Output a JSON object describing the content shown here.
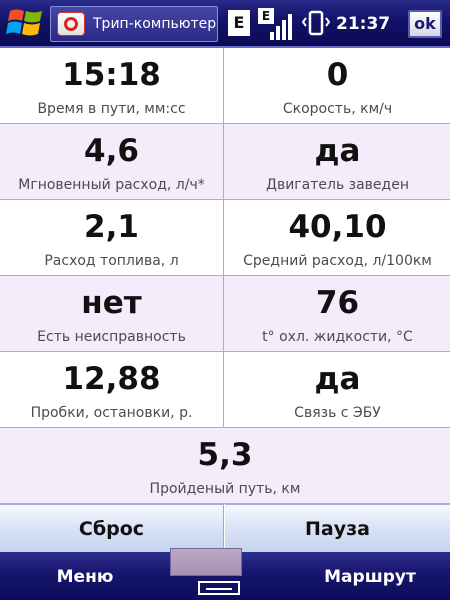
{
  "titlebar": {
    "app_title": "Трип-компьютер",
    "tray_e1": "E",
    "tray_e2": "E",
    "clock": "21:37",
    "ok_label": "ok"
  },
  "metrics": [
    {
      "value": "15:18",
      "label": "Время в пути, мм:сс"
    },
    {
      "value": "0",
      "label": "Скорость, км/ч"
    },
    {
      "value": "4,6",
      "label": "Мгновенный расход, л/ч*"
    },
    {
      "value": "да",
      "label": "Двигатель заведен"
    },
    {
      "value": "2,1",
      "label": "Расход топлива, л"
    },
    {
      "value": "40,10",
      "label": "Средний расход, л/100км"
    },
    {
      "value": "нет",
      "label": "Есть неисправность"
    },
    {
      "value": "76",
      "label": "t° охл. жидкости, °C"
    },
    {
      "value": "12,88",
      "label": "Пробки, остановки, р."
    },
    {
      "value": "да",
      "label": "Связь с ЭБУ"
    },
    {
      "value": "5,3",
      "label": "Пройденый путь, км"
    }
  ],
  "actions": {
    "reset_label": "Сброс",
    "pause_label": "Пауза"
  },
  "softkeys": {
    "left_label": "Меню",
    "right_label": "Маршрут"
  },
  "icons": {
    "start": "windows-flag-icon",
    "app": "trip-computer-icon",
    "signal": "signal-strength-icon",
    "phone": "phone-vibrate-icon",
    "keyboard": "keyboard-icon"
  },
  "colors": {
    "titlebar": "#14146a",
    "row_alt": "#f4ebfb",
    "button": "#dbe4f6"
  }
}
